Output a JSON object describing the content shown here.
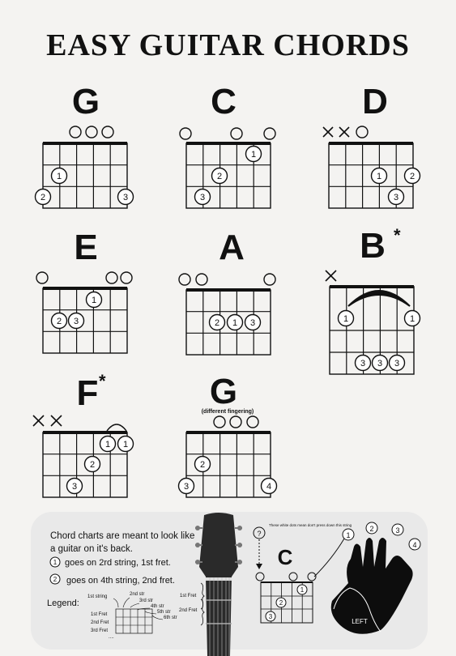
{
  "title": "EASY GUITAR CHORDS",
  "chords": [
    {
      "name": "G",
      "sup": ""
    },
    {
      "name": "C",
      "sup": ""
    },
    {
      "name": "D",
      "sup": ""
    },
    {
      "name": "E",
      "sup": ""
    },
    {
      "name": "A",
      "sup": ""
    },
    {
      "name": "B",
      "sup": "*"
    },
    {
      "name": "F",
      "sup": "*"
    },
    {
      "name": "G",
      "sup": "",
      "subtitle": "(different fingering)"
    }
  ],
  "finger_labels": [
    "1",
    "2",
    "3",
    "4"
  ],
  "legend": {
    "intro": "Chord charts are meant to look like a guitar on it's back.",
    "note1": "goes on 2rd string, 1st fret.",
    "note2": "goes on 4th string, 2nd fret.",
    "legend_label": "Legend:",
    "strings": [
      "1st string",
      "2nd str",
      "3rd str",
      "4th str",
      "5th str",
      "6th str"
    ],
    "frets": [
      "1st Fret",
      "2nd Fret",
      "3rd Fret",
      "...."
    ],
    "neck_frets": [
      "1st Fret",
      "2nd Fret"
    ],
    "white_dots_note": "These white dots mean don't press down this string",
    "example_chord": "C",
    "hand_label": "LEFT"
  }
}
